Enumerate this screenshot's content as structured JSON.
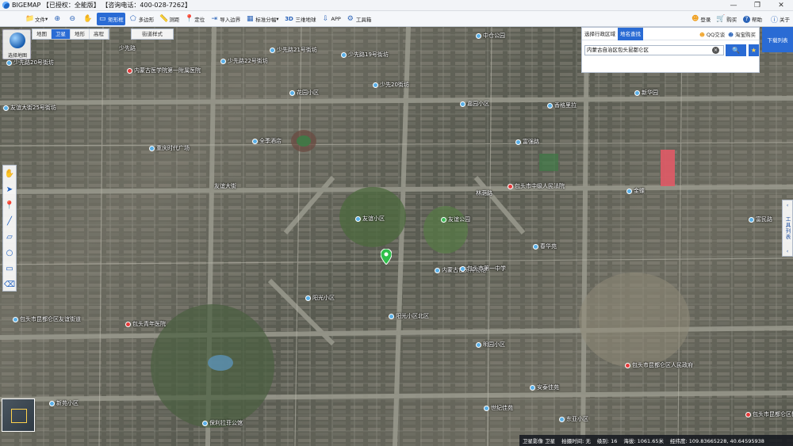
{
  "titlebar": {
    "title": "BIGEMAP 【已授权：全能版】 【咨询电话：400-028-7262】",
    "minimize": "—",
    "maximize": "❐",
    "close": "✕"
  },
  "toolbar": {
    "items": [
      {
        "label": "文件",
        "icon": "folder-icon",
        "glyph": "📁"
      },
      {
        "label": "",
        "icon": "zoom-in-icon",
        "glyph": "⊕"
      },
      {
        "label": "",
        "icon": "zoom-out-icon",
        "glyph": "⊖"
      },
      {
        "label": "",
        "icon": "pan-hand-icon",
        "glyph": "✋"
      },
      {
        "label": "矩形框",
        "icon": "rectangle-select-icon",
        "glyph": "▭",
        "active": true
      },
      {
        "label": "多边形",
        "icon": "polygon-icon",
        "glyph": "⬠"
      },
      {
        "label": "测距",
        "icon": "ruler-icon",
        "glyph": "📏"
      },
      {
        "label": "定位",
        "icon": "location-pin-icon",
        "glyph": "📍"
      },
      {
        "label": "导入边界",
        "icon": "import-boundary-icon",
        "glyph": "⇥"
      },
      {
        "label": "标准分幅",
        "icon": "grid-sheet-icon",
        "glyph": "▦"
      },
      {
        "label": "三维地球",
        "icon": "3d-globe-icon",
        "glyph": "3D"
      },
      {
        "label": "APP",
        "icon": "app-download-icon",
        "glyph": "⇩"
      },
      {
        "label": "工具箱",
        "icon": "gear-icon",
        "glyph": "⚙"
      }
    ],
    "right": {
      "login": "登录",
      "buy": "购买",
      "help": "帮助",
      "about": "关于"
    }
  },
  "layers": {
    "tabs": [
      {
        "label": "地图",
        "on": false
      },
      {
        "label": "卫星",
        "on": true
      },
      {
        "label": "地形",
        "on": false
      },
      {
        "label": "高程",
        "on": false
      }
    ],
    "street_style": "街道样式"
  },
  "globe": {
    "label": "选择地图"
  },
  "search": {
    "tab_region": "选择行政区域",
    "tab_search": "地名查找",
    "qq": "QQ交谈",
    "taobao": "淘宝购买",
    "value": "内蒙古自治区包头昆都仑区",
    "clear": "×",
    "go": "🔍",
    "star": "★"
  },
  "download_list": "下载列表",
  "left_tools": [
    "✋",
    "➤",
    "📍",
    "╱",
    "▱",
    "○",
    "▭",
    "⌫"
  ],
  "right_tools": {
    "arrow_top": "‹",
    "label": "工具列表",
    "arrow_bottom": "‹"
  },
  "status": {
    "layer": "卫星影像 卫星",
    "capture_time": "拍摄时间: 无",
    "level": "级别: 16",
    "altitude": "海拔: 1061.65米",
    "lnglat": "经纬度: 109.83665228, 40.64595938"
  },
  "pois": [
    {
      "label": "少先路20号街坊",
      "type": "blue"
    },
    {
      "label": "少先路21号街坊",
      "type": "blue"
    },
    {
      "label": "少先路22号街坊",
      "type": "blue"
    },
    {
      "label": "少先路23号街坊",
      "type": "blue"
    },
    {
      "label": "少先路19号街坊",
      "type": "blue"
    },
    {
      "label": "内蒙古医学院第一附属医院",
      "type": "red"
    },
    {
      "label": "友谊18号街坊",
      "type": "blue"
    },
    {
      "label": "中仓公园",
      "type": "blue"
    },
    {
      "label": "友谊大街25号街坊",
      "type": "blue"
    },
    {
      "label": "少先20街坊",
      "type": "blue"
    },
    {
      "label": "花园小区",
      "type": "blue"
    },
    {
      "label": "嘉园小区",
      "type": "blue"
    },
    {
      "label": "香格里拉",
      "type": "blue"
    },
    {
      "label": "富强路",
      "type": "blue"
    },
    {
      "label": "重庆时代广场",
      "type": "blue"
    },
    {
      "label": "全季酒店",
      "type": "blue"
    },
    {
      "label": "包头市中级人民法院",
      "type": "red"
    },
    {
      "label": "友谊小区",
      "type": "blue"
    },
    {
      "label": "友谊公园",
      "type": "green"
    },
    {
      "label": "内蒙古包头博物馆",
      "type": "blue"
    },
    {
      "label": "包头青年医院",
      "type": "red"
    },
    {
      "label": "包头市昆都仑区友谊街道",
      "type": "blue"
    },
    {
      "label": "阳光小区",
      "type": "blue"
    },
    {
      "label": "包头市昆都仑区人民政府",
      "type": "red"
    },
    {
      "label": "包头市第一中学",
      "type": "blue"
    },
    {
      "label": "青年路",
      "type": "blue"
    },
    {
      "label": "明园小区",
      "type": "blue"
    },
    {
      "label": "保利拉菲公馆",
      "type": "blue"
    },
    {
      "label": "新苑小区",
      "type": "blue"
    },
    {
      "label": "世纪佳苑",
      "type": "blue"
    },
    {
      "label": "东亚小区",
      "type": "blue"
    },
    {
      "label": "春华苑",
      "type": "blue"
    },
    {
      "label": "阳光小区北区",
      "type": "blue"
    },
    {
      "label": "安泰佳苑",
      "type": "blue"
    },
    {
      "label": "金蝶",
      "type": "blue"
    },
    {
      "label": "富民路",
      "type": "blue"
    },
    {
      "label": "包头市昆都仑区教育局",
      "type": "red"
    },
    {
      "label": "友谊大街",
      "type": "blue"
    },
    {
      "label": "新华园",
      "type": "blue"
    },
    {
      "label": "少先路",
      "type": "blue"
    },
    {
      "label": "林荫路",
      "type": "blue"
    }
  ]
}
